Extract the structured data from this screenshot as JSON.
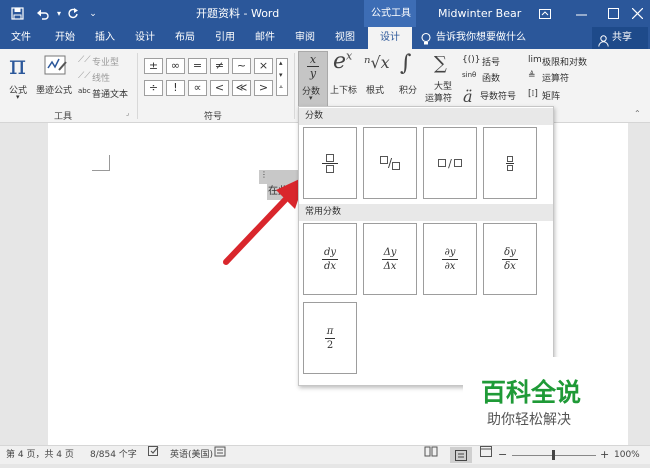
{
  "titlebar": {
    "doc_title": "开题资料 - Word",
    "context_tab": "公式工具",
    "user": "Midwinter Bear",
    "icons": [
      "save-icon",
      "undo-icon",
      "redo-icon",
      "customize-icon",
      "ribbon-display-icon",
      "minimize-icon",
      "maximize-icon",
      "close-icon"
    ]
  },
  "tabs": [
    {
      "label": "文件"
    },
    {
      "label": "开始"
    },
    {
      "label": "插入"
    },
    {
      "label": "设计"
    },
    {
      "label": "布局"
    },
    {
      "label": "引用"
    },
    {
      "label": "邮件"
    },
    {
      "label": "审阅"
    },
    {
      "label": "视图"
    },
    {
      "label": "设计",
      "active": true
    }
  ],
  "tell_me": "告诉我你想要做什么",
  "share": "共享",
  "ribbon": {
    "tools": {
      "equation": "公式",
      "ink_equation": "墨迹公式",
      "professional": "专业型",
      "linear": "线性",
      "normal_text": "普通文本",
      "group_label": "工具"
    },
    "symbols": {
      "row1": [
        "±",
        "∞",
        "=",
        "≠",
        "~",
        "×"
      ],
      "row2": [
        "÷",
        "!",
        "∝",
        "<",
        "≪",
        ">"
      ],
      "group_label": "符号"
    },
    "structures": {
      "fraction": "分数",
      "script": "上下标",
      "radical": "根式",
      "integral": "积分",
      "large_operator_1": "大型",
      "large_operator_2": "运算符",
      "bracket": "括号",
      "function": "函数",
      "accent": "导数符号",
      "limit_log": "极限和对数",
      "operator": "运算符",
      "matrix": "矩阵"
    }
  },
  "dropdown": {
    "section_fraction": "分数",
    "section_common": "常用分数",
    "common": [
      {
        "num": "dy",
        "den": "dx"
      },
      {
        "num": "Δy",
        "den": "Δx"
      },
      {
        "num": "∂y",
        "den": "∂x"
      },
      {
        "num": "δy",
        "den": "δx"
      },
      {
        "num": "π",
        "den": "2"
      }
    ]
  },
  "document": {
    "placeholder": "在此处"
  },
  "statusbar": {
    "page": "第 4 页，共 4 页",
    "words": "8/854 个字",
    "language": "英语(美国)",
    "zoom": "100%"
  },
  "watermark": {
    "title": "百科全说",
    "subtitle": "助你轻松解决"
  },
  "colors": {
    "word_blue": "#2b579a",
    "arrow_red": "#d9262c",
    "watermark_green": "#1f9a37"
  }
}
